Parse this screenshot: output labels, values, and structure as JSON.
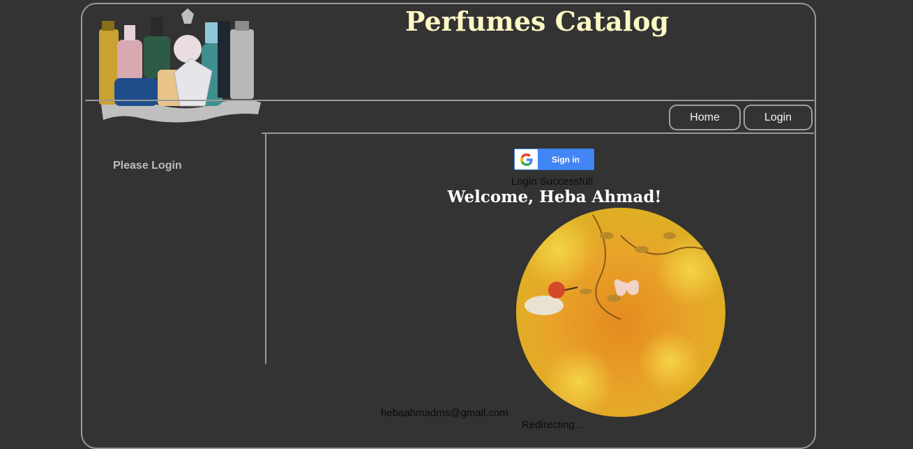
{
  "header": {
    "title": "Perfumes Catalog",
    "logo_icon": "perfume-bottles-logo"
  },
  "nav": {
    "home_label": "Home",
    "login_label": "Login"
  },
  "sidebar": {
    "message": "Please Login"
  },
  "main": {
    "google_signin_label": "Sign in",
    "login_status": "Login Successful!",
    "welcome_text": "Welcome, Heba Ahmad!",
    "email": "hebaahmadms@gmail.com",
    "redirect_text": "Redirecting..."
  },
  "colors": {
    "background": "#333333",
    "title": "#fff8c4",
    "border": "#9a9a9a",
    "google_blue": "#4285f4"
  }
}
